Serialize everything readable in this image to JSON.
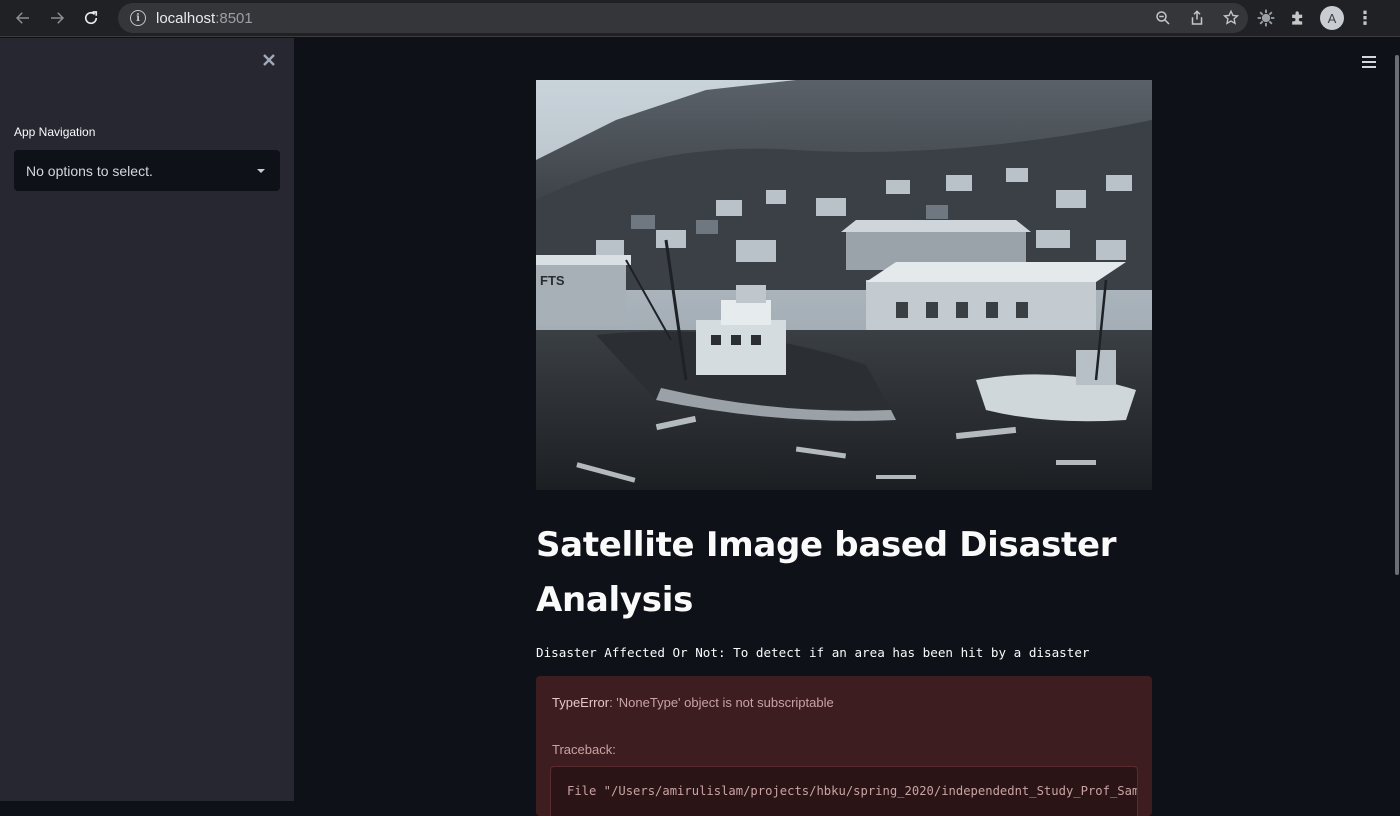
{
  "browser": {
    "url_host": "localhost",
    "url_port": ":8501",
    "avatar_letter": "A",
    "icons": [
      "back-arrow-icon",
      "forward-arrow-icon",
      "reload-icon",
      "site-info-icon",
      "zoom-icon",
      "share-icon",
      "bookmark-star-icon",
      "extension-gear-icon",
      "puzzle-extensions-icon",
      "profile-avatar",
      "menu-kebab-icon"
    ]
  },
  "sidebar": {
    "nav_label": "App Navigation",
    "select_value": "No options to select.",
    "icons": [
      "close-icon",
      "chevron-down-icon"
    ]
  },
  "main": {
    "menu_icon": "hamburger-menu-icon",
    "title": "Satellite Image based Disaster Analysis",
    "subtitle": "Disaster Affected Or Not: To detect if an area has been hit by a disaster",
    "error": {
      "type": "TypeError",
      "message": ": 'NoneType' object is not subscriptable",
      "traceback_label": "Traceback:",
      "traceback_line": "File \"/Users/amirulislam/projects/hbku/spring_2020/independednt_Study_Prof_Sam"
    }
  },
  "colors": {
    "sidebar_bg": "#262730",
    "main_bg": "#0e1117",
    "error_bg": "#3e1d20",
    "chrome_bg": "#202124"
  }
}
